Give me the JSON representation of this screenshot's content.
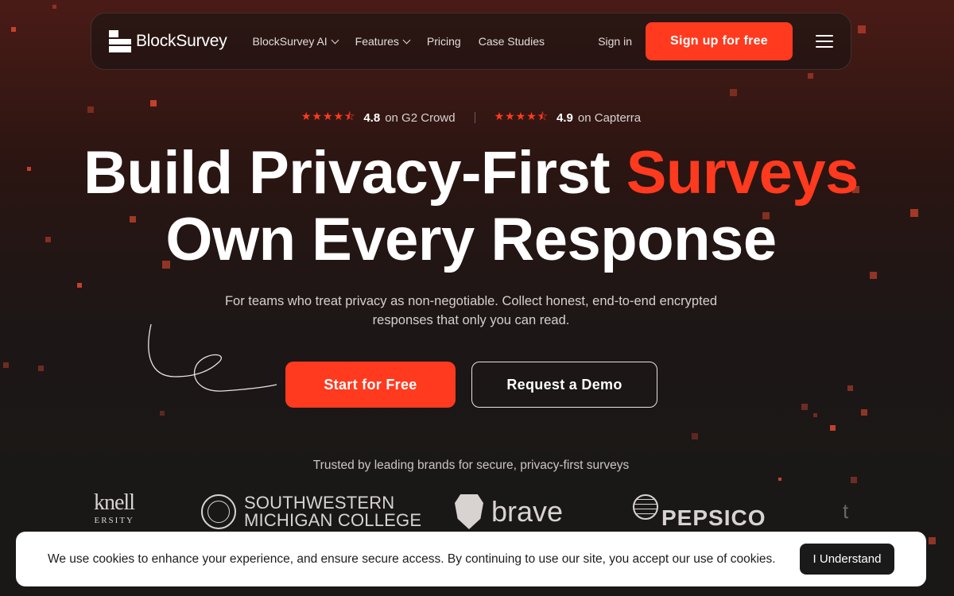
{
  "brand": {
    "name": "BlockSurvey"
  },
  "nav": {
    "links": [
      {
        "label": "BlockSurvey AI",
        "has_dropdown": true
      },
      {
        "label": "Features",
        "has_dropdown": true
      },
      {
        "label": "Pricing",
        "has_dropdown": false
      },
      {
        "label": "Case Studies",
        "has_dropdown": false
      }
    ],
    "signin_label": "Sign in",
    "signup_label": "Sign up for free",
    "menu_icon": "hamburger-icon"
  },
  "ratings": [
    {
      "score": "4.8",
      "source": "on G2 Crowd",
      "stars": 4.5
    },
    {
      "score": "4.9",
      "source": "on Capterra",
      "stars": 4.5
    }
  ],
  "hero": {
    "title_line1": "Build Privacy-First ",
    "title_accent": "Surveys",
    "title_line2": "Own Every Response",
    "subtitle": "For teams who treat privacy as non-negotiable. Collect honest, end-to-end encrypted responses that only you can read.",
    "primary_cta": "Start for Free",
    "secondary_cta": "Request a Demo"
  },
  "trusted": {
    "label": "Trusted by leading brands for secure, privacy-first surveys",
    "logos": [
      {
        "name": "Bucknell University",
        "text": "knell",
        "subtext": "ERSITY"
      },
      {
        "name": "Southwestern Michigan College",
        "line1": "SOUTHWESTERN",
        "line2": "MICHIGAN COLLEGE"
      },
      {
        "name": "Brave",
        "text": "brave"
      },
      {
        "name": "PepsiCo",
        "text": "PEPSICO"
      }
    ]
  },
  "cookie": {
    "text": "We use cookies to enhance your experience, and ensure secure access. By continuing to use our site, you accept our use of cookies.",
    "button": "I Understand"
  },
  "colors": {
    "accent": "#ff3a1f",
    "background": "#1c1716"
  }
}
